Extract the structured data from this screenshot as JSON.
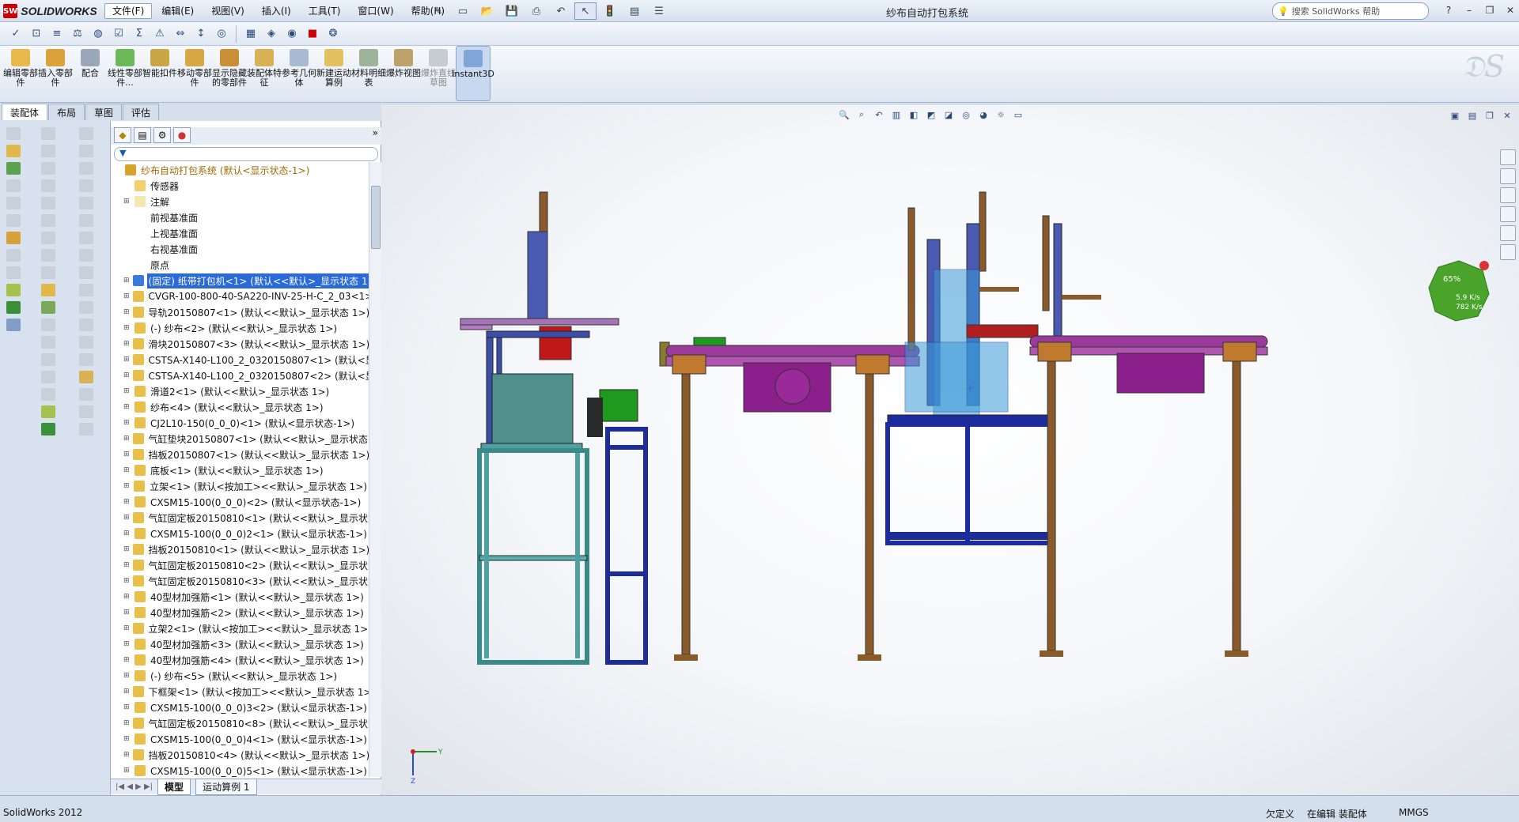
{
  "app": {
    "logo_text": "SOLIDWORKS",
    "logo_badge": "SW",
    "document_title": "纱布自动打包系统"
  },
  "menu": [
    "文件(F)",
    "编辑(E)",
    "视图(V)",
    "插入(I)",
    "工具(T)",
    "窗口(W)",
    "帮助(H)"
  ],
  "help_search_placeholder": "搜索 SolidWorks 帮助",
  "command_manager": [
    {
      "label": "编辑零部件",
      "icon": "edit-component-icon"
    },
    {
      "label": "插入零部件",
      "icon": "insert-component-icon"
    },
    {
      "label": "配合",
      "icon": "mate-icon"
    },
    {
      "label": "线性零部件...",
      "icon": "linear-pattern-icon"
    },
    {
      "label": "智能扣件",
      "icon": "smart-fastener-icon"
    },
    {
      "label": "移动零部件",
      "icon": "move-component-icon"
    },
    {
      "label": "显示隐藏的零部件",
      "icon": "show-hidden-icon"
    },
    {
      "label": "装配体特征",
      "icon": "assembly-feature-icon"
    },
    {
      "label": "参考几何体",
      "icon": "reference-geometry-icon"
    },
    {
      "label": "新建运动算例",
      "icon": "new-motion-study-icon"
    },
    {
      "label": "材料明细表",
      "icon": "bom-icon"
    },
    {
      "label": "爆炸视图",
      "icon": "exploded-view-icon"
    },
    {
      "label": "爆炸直线草图",
      "icon": "explode-line-sketch-icon"
    },
    {
      "label": "Instant3D",
      "icon": "instant3d-icon"
    }
  ],
  "command_tabs": [
    "装配体",
    "布局",
    "草图",
    "评估"
  ],
  "feature_tree": {
    "root": "纱布自动打包系统 (默认<显示状态-1>)",
    "items": [
      "传感器",
      "注解",
      "前视基准面",
      "上视基准面",
      "右视基准面",
      "原点",
      "(固定) 纸带打包机<1> (默认<<默认>_显示状态 1>)",
      "CVGR-100-800-40-SA220-INV-25-H-C_2_03<1> (",
      "导轨20150807<1> (默认<<默认>_显示状态 1>)",
      "(-) 纱布<2> (默认<<默认>_显示状态 1>)",
      "滑块20150807<3> (默认<<默认>_显示状态 1>)",
      "CSTSA-X140-L100_2_0320150807<1> (默认<显示",
      "CSTSA-X140-L100_2_0320150807<2> (默认<显示",
      "滑道2<1> (默认<<默认>_显示状态 1>)",
      "纱布<4> (默认<<默认>_显示状态 1>)",
      "CJ2L10-150(0_0_0)<1> (默认<显示状态-1>)",
      "气缸垫块20150807<1> (默认<<默认>_显示状态 1>",
      "挡板20150807<1> (默认<<默认>_显示状态 1>)",
      "底板<1> (默认<<默认>_显示状态 1>)",
      "立架<1> (默认<按加工><<默认>_显示状态 1>)",
      "CXSM15-100(0_0_0)<2> (默认<显示状态-1>)",
      "气缸固定板20150810<1> (默认<<默认>_显示状态",
      "CXSM15-100(0_0_0)2<1> (默认<显示状态-1>)",
      "挡板20150810<1> (默认<<默认>_显示状态 1>)",
      "气缸固定板20150810<2> (默认<<默认>_显示状态",
      "气缸固定板20150810<3> (默认<<默认>_显示状态",
      "40型材加强筋<1> (默认<<默认>_显示状态 1>)",
      "40型材加强筋<2> (默认<<默认>_显示状态 1>)",
      "立架2<1> (默认<按加工><<默认>_显示状态 1>)",
      "40型材加强筋<3> (默认<<默认>_显示状态 1>)",
      "40型材加强筋<4> (默认<<默认>_显示状态 1>)",
      "(-) 纱布<5> (默认<<默认>_显示状态 1>)",
      "下框架<1> (默认<按加工><<默认>_显示状态 1>)",
      "CXSM15-100(0_0_0)3<2> (默认<显示状态-1>)",
      "气缸固定板20150810<8> (默认<<默认>_显示状态",
      "CXSM15-100(0_0_0)4<1> (默认<显示状态-1>)",
      "挡板20150810<4> (默认<<默认>_显示状态 1>)",
      "CXSM15-100(0_0_0)5<1> (默认<显示状态-1>)"
    ]
  },
  "bottom_tabs": [
    "模型",
    "运动算例 1"
  ],
  "performance": {
    "percent": "65%",
    "up": "5.9 K/s",
    "down": "782 K/s"
  },
  "status": {
    "app_version": "SolidWorks 2012",
    "under_defined": "欠定义",
    "editing": "在编辑 装配体",
    "units": "MMGS"
  }
}
